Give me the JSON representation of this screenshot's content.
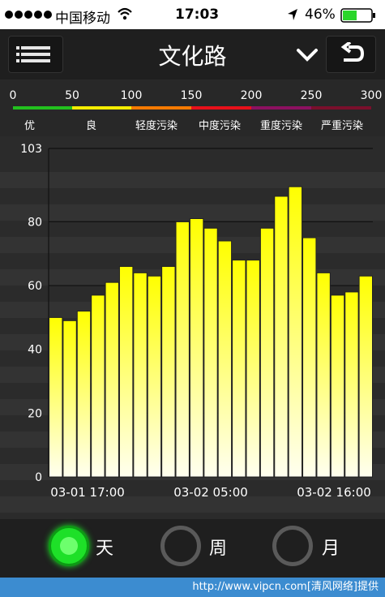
{
  "status_bar": {
    "carrier": "中国移动",
    "time": "17:03",
    "battery": "46%",
    "signal_dots": 5
  },
  "nav": {
    "title": "文化路",
    "menu_icon": "list-menu-icon",
    "dropdown_icon": "chevron-down-icon",
    "back_icon": "return-arrow-icon"
  },
  "aqi_legend": {
    "ticks": [
      "0",
      "50",
      "100",
      "150",
      "200",
      "250",
      "300"
    ],
    "levels": [
      {
        "label": "优",
        "color": "#22c01e"
      },
      {
        "label": "良",
        "color": "#f5ee00"
      },
      {
        "label": "轻度污染",
        "color": "#f57a00"
      },
      {
        "label": "中度污染",
        "color": "#e8101a"
      },
      {
        "label": "重度污染",
        "color": "#8c1060"
      },
      {
        "label": "严重污染",
        "color": "#7a0f2c"
      }
    ]
  },
  "chart_data": {
    "type": "bar",
    "title": "",
    "xlabel": "",
    "ylabel": "",
    "ylim": [
      0,
      103
    ],
    "y_ticks": [
      "0",
      "20",
      "40",
      "60",
      "80",
      "103"
    ],
    "x_tick_labels": [
      "03-01 17:00",
      "03-02 05:00",
      "03-02 16:00"
    ],
    "values": [
      50,
      49,
      52,
      57,
      61,
      66,
      64,
      63,
      66,
      80,
      81,
      78,
      74,
      68,
      68,
      78,
      88,
      91,
      75,
      64,
      57,
      58,
      63
    ],
    "grid": true,
    "bar_color_top": "#ffff00",
    "bar_color_bottom": "#fffff0"
  },
  "period_selector": {
    "options": [
      {
        "label": "天",
        "selected": true
      },
      {
        "label": "周",
        "selected": false
      },
      {
        "label": "月",
        "selected": false
      }
    ],
    "selected_color": "#1ee028"
  },
  "footer": {
    "text": "http://www.vipcn.com[清风网络]提供"
  }
}
